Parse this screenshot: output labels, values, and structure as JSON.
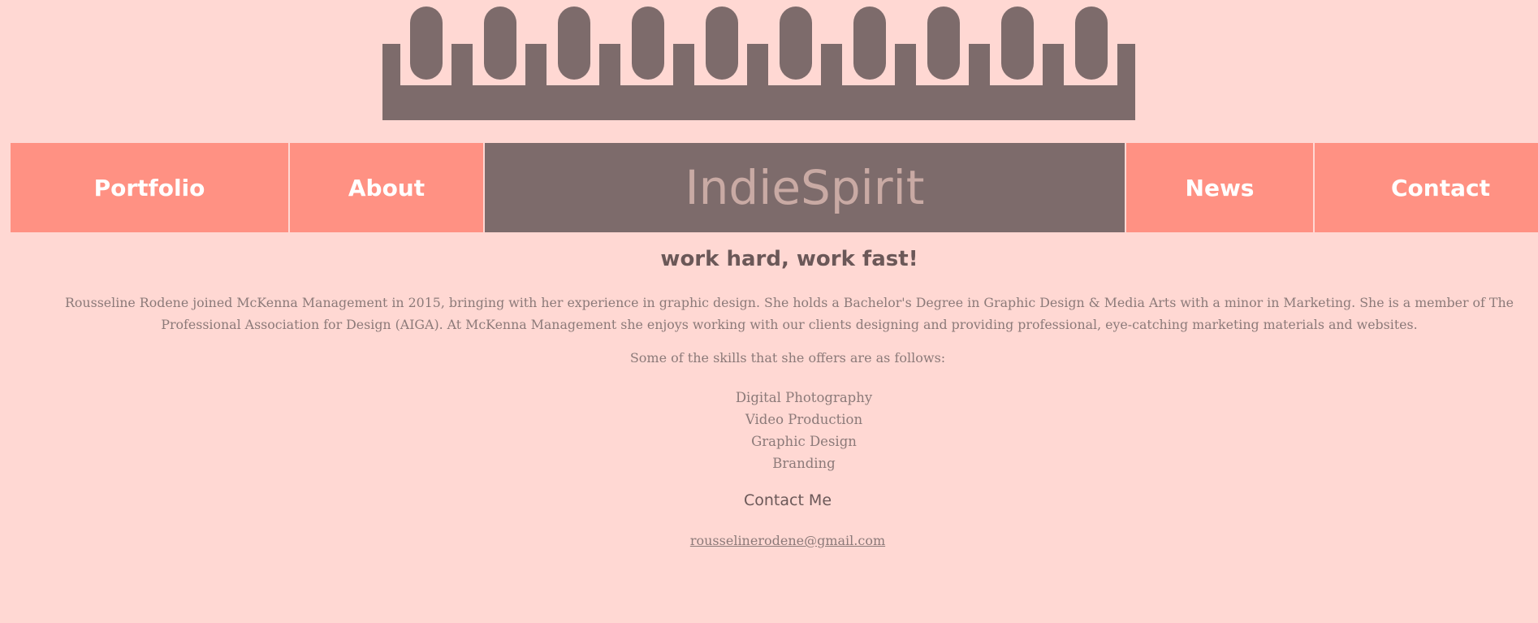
{
  "nav": {
    "items": [
      {
        "label": "Portfolio"
      },
      {
        "label": "About"
      },
      {
        "label": "IndieSpirit"
      },
      {
        "label": "News"
      },
      {
        "label": "Contact"
      }
    ]
  },
  "tagline": "work hard, work fast!",
  "bio": "Rousseline Rodene joined McKenna Management in 2015, bringing with her experience in graphic design. She holds a Bachelor's Degree in Graphic Design & Media Arts with a minor in Marketing. She is a member of The Professional Association for Design (AIGA). At McKenna Management she enjoys working with our clients designing and providing professional, eye-catching marketing materials and websites.",
  "skills_intro": "Some of the skills that she offers are as follows:",
  "skills": [
    "Digital Photography",
    "Video Production",
    "Graphic Design",
    "Branding"
  ],
  "contact_heading": "Contact Me",
  "email": "rousselinerodene@gmail.com",
  "colors": {
    "background": "#ffd8d3",
    "nav": "#ff9183",
    "brand": "#7d6b6b",
    "text": "#8c7a79"
  }
}
